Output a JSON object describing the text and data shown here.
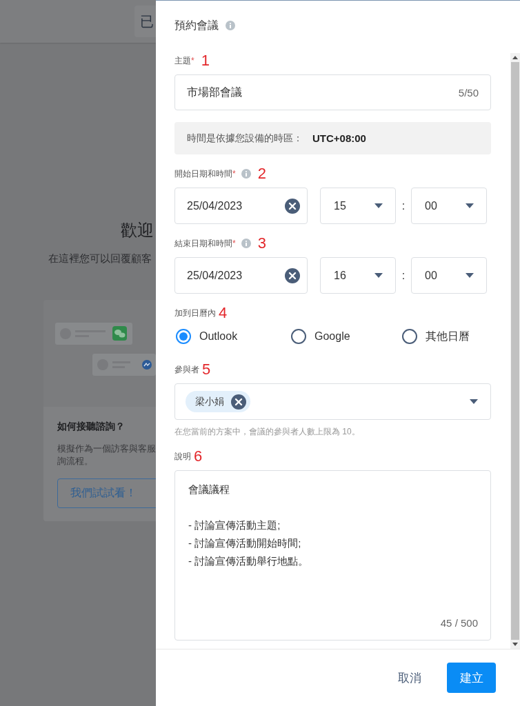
{
  "background": {
    "top_button": "已",
    "heading": "歡迎",
    "subtitle": "在這裡您可以回覆顧客",
    "card": {
      "title": "如何接聽諮詢？",
      "description_lines": [
        "模擬作為一個訪客與客服",
        "詢流程。"
      ],
      "button": "我們試試看！"
    }
  },
  "dialog": {
    "title": "預約會議",
    "title_info": true,
    "fields": [
      {
        "kind": "text",
        "label": "主題",
        "required_mark": "*",
        "annotation": "1",
        "value": "市場部會議",
        "counter": "5/50"
      },
      {
        "kind": "notice",
        "text": "時間是依據您設備的時區：",
        "value": "UTC+08:00"
      },
      {
        "kind": "datetime",
        "label": "開始日期和時間",
        "required_mark": "*",
        "info": true,
        "annotation": "2",
        "date": "25/04/2023",
        "hour": "15",
        "separator": ":",
        "minute": "00"
      },
      {
        "kind": "datetime",
        "label": "結束日期和時間",
        "required_mark": "*",
        "info": true,
        "annotation": "3",
        "date": "25/04/2023",
        "hour": "16",
        "separator": ":",
        "minute": "00"
      },
      {
        "kind": "radio",
        "label": "加到日曆內",
        "annotation": "4",
        "options": [
          {
            "label": "Outlook",
            "selected": true
          },
          {
            "label": "Google",
            "selected": false
          },
          {
            "label": "其他日曆",
            "selected": false
          }
        ]
      },
      {
        "kind": "tags",
        "label": "參與者",
        "annotation": "5",
        "tags": [
          "梁小娟"
        ],
        "hint": "在您當前的方案中，會議的參與者人數上限為 10。"
      },
      {
        "kind": "textarea",
        "label": "說明",
        "annotation": "6",
        "paragraphs": [
          [
            "會議議程"
          ],
          [
            "- 討論宣傳活動主題;",
            "- 討論宣傳活動開始時間;",
            "- 討論宣傳活動舉行地點。"
          ]
        ],
        "counter": "45 / 500"
      }
    ],
    "buttons": [
      {
        "kind": "secondary",
        "label": "取消"
      },
      {
        "kind": "primary",
        "label": "建立"
      }
    ]
  }
}
